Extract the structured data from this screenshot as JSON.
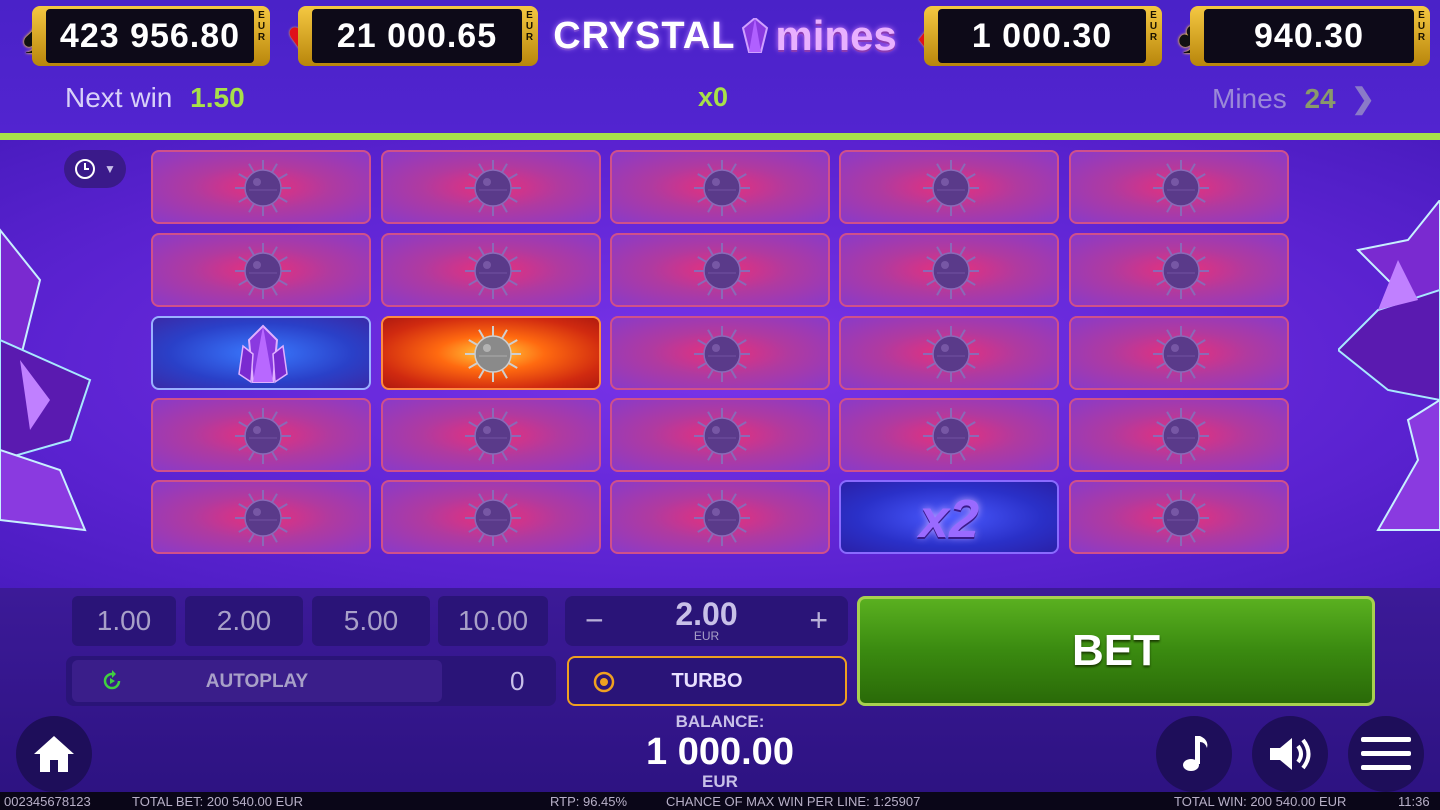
{
  "jackpots": [
    {
      "suit": "♠",
      "value": "423 956.80",
      "currency": "EUR",
      "color": "#111111"
    },
    {
      "suit": "♥",
      "value": "21 000.65",
      "currency": "EUR",
      "color": "#e0101a"
    },
    {
      "suit": "♦",
      "value": "1 000.30",
      "currency": "EUR",
      "color": "#e0101a"
    },
    {
      "suit": "♣",
      "value": "940.30",
      "currency": "EUR",
      "color": "#111111"
    }
  ],
  "logo": {
    "part1": "CRYSTAL",
    "part2": "mines"
  },
  "info": {
    "next_win_label": "Next win",
    "next_win_value": "1.50",
    "multiplier": "x0",
    "mines_label": "Mines",
    "mines_value": "24"
  },
  "board": {
    "rows": 5,
    "cols": 5,
    "special": {
      "gem": [
        2,
        0
      ],
      "explosion": [
        2,
        1
      ],
      "multiplier": [
        4,
        3
      ]
    },
    "multiplier_text": "x2"
  },
  "controls": {
    "chips": [
      "1.00",
      "2.00",
      "5.00",
      "10.00"
    ],
    "stake": {
      "minus": "−",
      "value": "2.00",
      "currency": "EUR",
      "plus": "+"
    },
    "autoplay_label": "AUTOPLAY",
    "autoplay_count": "0",
    "turbo_label": "TURBO",
    "bet_label": "BET"
  },
  "balance": {
    "label": "BALANCE:",
    "value": "1 000.00",
    "currency": "EUR"
  },
  "status": {
    "id": "002345678123",
    "total_bet": "TOTAL BET: 200 540.00 EUR",
    "rtp": "RTP: 96.45%",
    "chance": "CHANCE OF MAX WIN PER LINE: 1:25907",
    "total_win": "TOTAL WIN: 200 540.00 EUR",
    "time": "11:36"
  },
  "colors": {
    "accent_green": "#a8e04a",
    "bet_green": "#3a8a10",
    "turbo_border": "#f0a020",
    "tile_pink": "#e8307a"
  }
}
